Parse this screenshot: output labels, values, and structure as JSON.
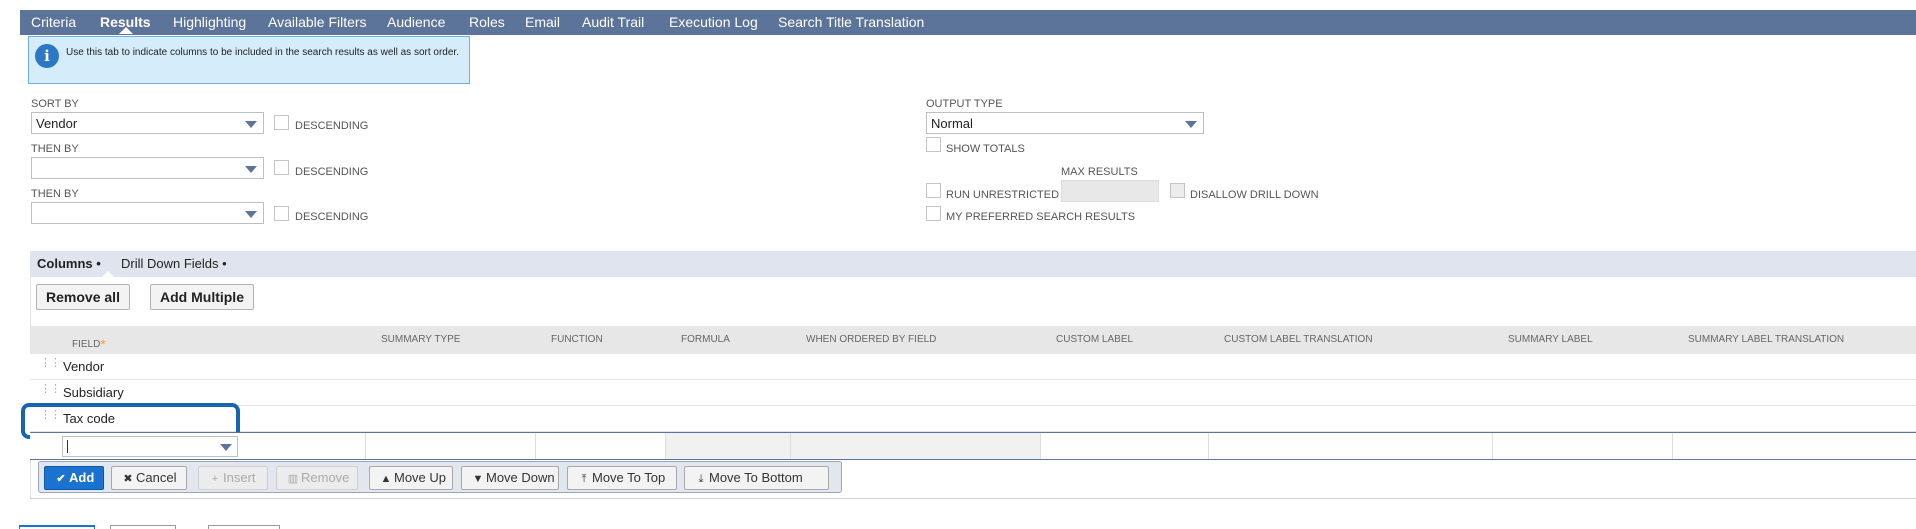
{
  "tabs": [
    "Criteria",
    "Results",
    "Highlighting",
    "Available Filters",
    "Audience",
    "Roles",
    "Email",
    "Audit Trail",
    "Execution Log",
    "Search Title Translation"
  ],
  "info": {
    "icon": "info-icon",
    "text": "Use this tab to indicate columns to be included in the search results as well as sort order."
  },
  "sort": {
    "sort_by_label": "SORT BY",
    "sort_by_value": "Vendor",
    "then_by_label_1": "THEN BY",
    "then_by_value_1": "",
    "then_by_label_2": "THEN BY",
    "then_by_value_2": "",
    "descending_label": "DESCENDING"
  },
  "output": {
    "output_type_label": "OUTPUT TYPE",
    "output_type_value": "Normal",
    "show_totals": "SHOW TOTALS",
    "max_results_label": "MAX RESULTS",
    "run_unrestricted": "RUN UNRESTRICTED",
    "disallow_drill_down": "DISALLOW DRILL DOWN",
    "my_preferred": "MY PREFERRED SEARCH RESULTS"
  },
  "subtabs": [
    "Columns •",
    "Drill Down Fields •"
  ],
  "buttons": {
    "remove_all": "Remove all",
    "add_multiple": "Add Multiple"
  },
  "columns": {
    "headers": [
      "FIELD",
      "SUMMARY TYPE",
      "FUNCTION",
      "FORMULA",
      "WHEN ORDERED BY FIELD",
      "CUSTOM LABEL",
      "CUSTOM LABEL TRANSLATION",
      "SUMMARY LABEL",
      "SUMMARY LABEL TRANSLATION"
    ],
    "required_mark": "*",
    "rows": [
      "Vendor",
      "Subsidiary",
      "Tax code"
    ]
  },
  "actions": {
    "add": "Add",
    "cancel": "Cancel",
    "insert": "Insert",
    "remove": "Remove",
    "move_up": "Move Up",
    "move_down": "Move Down",
    "move_to_top": "Move To Top",
    "move_to_bottom": "Move To Bottom"
  },
  "colors": {
    "tabbar": "#5c7499",
    "info_bg": "#d5ecfa",
    "primary": "#1a73d1",
    "highlight": "#1565b1"
  }
}
